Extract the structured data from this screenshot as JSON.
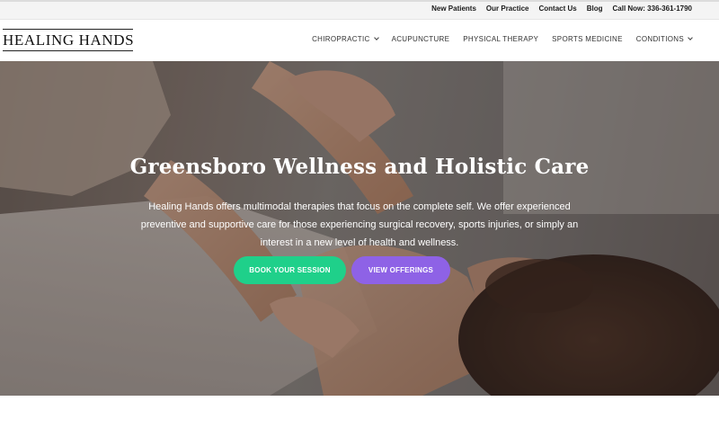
{
  "topbar": {
    "links": [
      "New Patients",
      "Our Practice",
      "Contact Us",
      "Blog",
      "Call Now: 336-361-1790"
    ]
  },
  "header": {
    "logo": "HEALING HANDS",
    "nav": [
      {
        "label": "CHIROPRACTIC",
        "dropdown": true
      },
      {
        "label": "ACUPUNCTURE",
        "dropdown": false
      },
      {
        "label": "PHYSICAL THERAPY",
        "dropdown": false
      },
      {
        "label": "SPORTS MEDICINE",
        "dropdown": false
      },
      {
        "label": "CONDITIONS",
        "dropdown": true
      }
    ]
  },
  "hero": {
    "title": "Greensboro Wellness and Holistic Care",
    "text": "Healing Hands offers multimodal therapies that focus on the complete self. We offer experienced preventive and supportive care for those experiencing surgical recovery, sports injuries, or simply an interest in a new level of health and wellness.",
    "buttons": {
      "book": "BOOK YOUR SESSION",
      "offerings": "VIEW OFFERINGS"
    }
  },
  "colors": {
    "book_button": "#1fd08a",
    "offerings_button": "#8e62e6",
    "topbar_bg": "#f4f4f4"
  }
}
